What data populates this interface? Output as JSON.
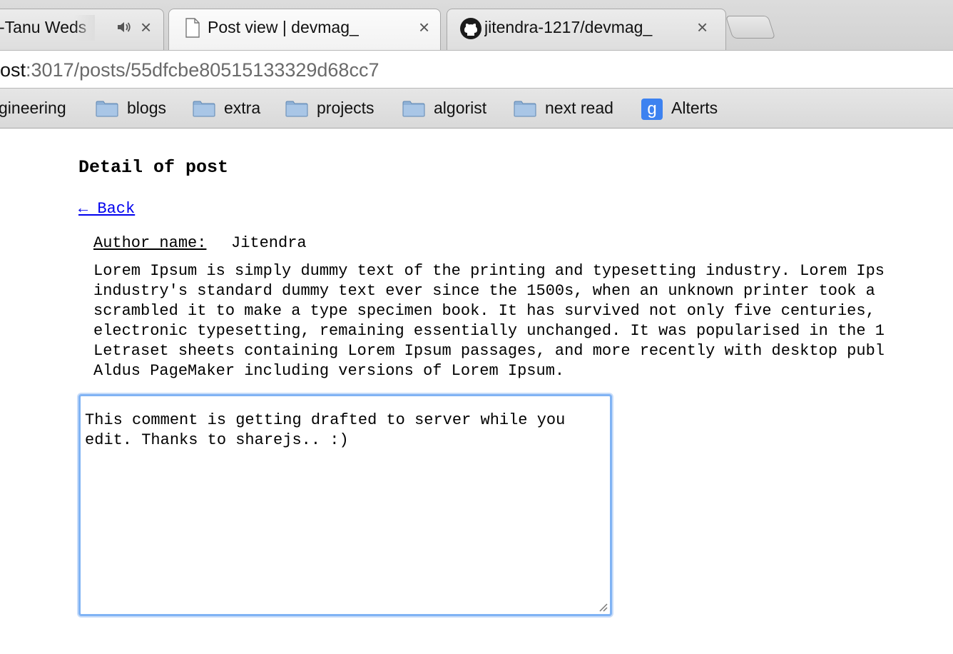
{
  "browser": {
    "tabs": [
      {
        "title": "-Tanu Weds Ma",
        "audio_icon": "speaker-icon",
        "favicon": "",
        "active": false
      },
      {
        "title": "Post view | devmag_",
        "favicon": "page-icon",
        "active": true
      },
      {
        "title": "jitendra-1217/devmag_",
        "favicon": "github-icon",
        "active": false
      }
    ],
    "close_glyph": "×",
    "address": {
      "host": "ost",
      "rest": ":3017/posts/55dfcbe80515133329d68cc7"
    },
    "bookmarks": [
      {
        "label": "gineering",
        "icon": "none"
      },
      {
        "label": "blogs",
        "icon": "folder-icon"
      },
      {
        "label": "extra",
        "icon": "folder-icon"
      },
      {
        "label": "projects",
        "icon": "folder-icon"
      },
      {
        "label": "algorist",
        "icon": "folder-icon"
      },
      {
        "label": "next read",
        "icon": "folder-icon"
      },
      {
        "label": "Alterts",
        "icon": "google-icon"
      }
    ],
    "google_glyph": "g"
  },
  "page": {
    "heading": "Detail of post",
    "back_link": "← Back",
    "author_label": "Author name:",
    "author_name": "Jitendra",
    "body_lines": [
      "Lorem Ipsum is simply dummy text of the printing and typesetting industry. Lorem Ips",
      "industry's standard dummy text ever since the 1500s, when an unknown printer took a",
      "scrambled it to make a type specimen book. It has survived not only five centuries,",
      "electronic typesetting, remaining essentially unchanged. It was popularised in the 1",
      "Letraset sheets containing Lorem Ipsum passages, and more recently with desktop publ",
      "Aldus PageMaker including versions of Lorem Ipsum."
    ],
    "comment_text": "This comment is getting drafted to server while you edit. Thanks to sharejs.. :)"
  },
  "colors": {
    "link": "#0000ee",
    "focus_ring": "#80b3f4",
    "google_blue": "#3d82f0"
  }
}
